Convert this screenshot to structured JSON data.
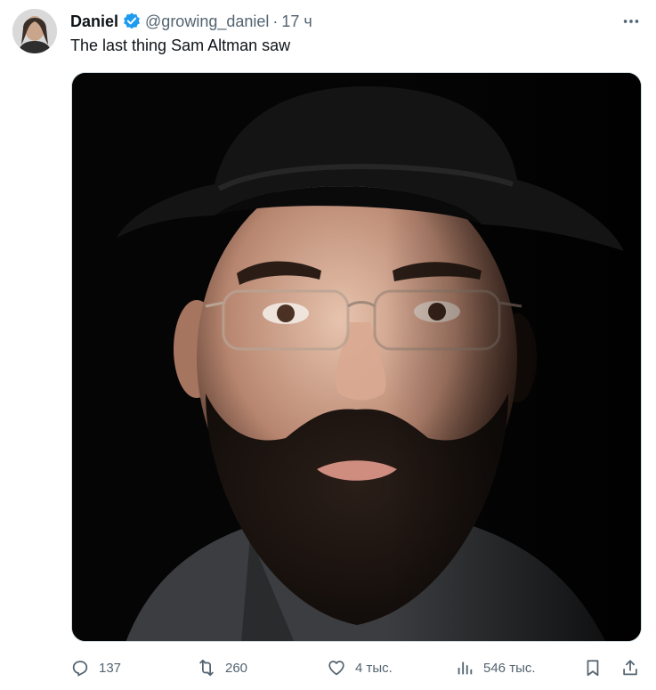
{
  "author": {
    "display_name": "Daniel",
    "handle": "@growing_daniel",
    "separator": "·",
    "time": "17 ч",
    "verified_color": "#1d9bf0"
  },
  "tweet": {
    "text": "The last thing Sam Altman saw"
  },
  "actions": {
    "replies": "137",
    "reposts": "260",
    "likes": "4 тыс.",
    "views": "546 тыс."
  },
  "icons": {
    "more": "more-dots-icon",
    "reply": "reply-icon",
    "repost": "repost-icon",
    "like": "heart-icon",
    "views": "views-bar-chart-icon",
    "bookmark": "bookmark-icon",
    "share": "share-icon"
  },
  "colors": {
    "text": "#0f1419",
    "muted": "#536471",
    "accent": "#1d9bf0"
  }
}
